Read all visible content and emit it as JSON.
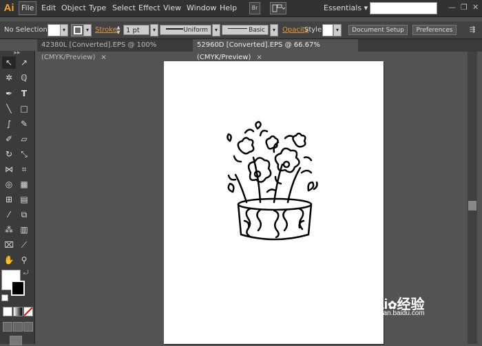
{
  "app": {
    "logo": "Ai"
  },
  "menu": [
    "File",
    "Edit",
    "Object",
    "Type",
    "Select",
    "Effect",
    "View",
    "Window",
    "Help"
  ],
  "menubar_right": {
    "bridge_icon": "Br",
    "workspace": "Essentials"
  },
  "control_bar": {
    "selection": "No Selection",
    "stroke_label": "Stroke:",
    "stroke_weight": "1 pt",
    "profile_uniform": "Uniform",
    "profile_basic": "Basic",
    "opacity_label": "Opacity",
    "style_label": "Style:",
    "document_setup": "Document Setup",
    "preferences": "Preferences"
  },
  "tabs": [
    {
      "label": "42380L [Converted].EPS @ 100% (CMYK/Preview)",
      "close": "×"
    },
    {
      "label": "52960D [Converted].EPS @ 66.67% (CMYK/Preview)",
      "close": "×"
    }
  ],
  "watermark": {
    "brand": "Bai",
    "brand_cn": "经验",
    "url": "jingyan.baidu.com"
  },
  "colors": {
    "accent": "#e29b3e",
    "canvas_bg": "#535353",
    "logo": "#f5a623"
  }
}
